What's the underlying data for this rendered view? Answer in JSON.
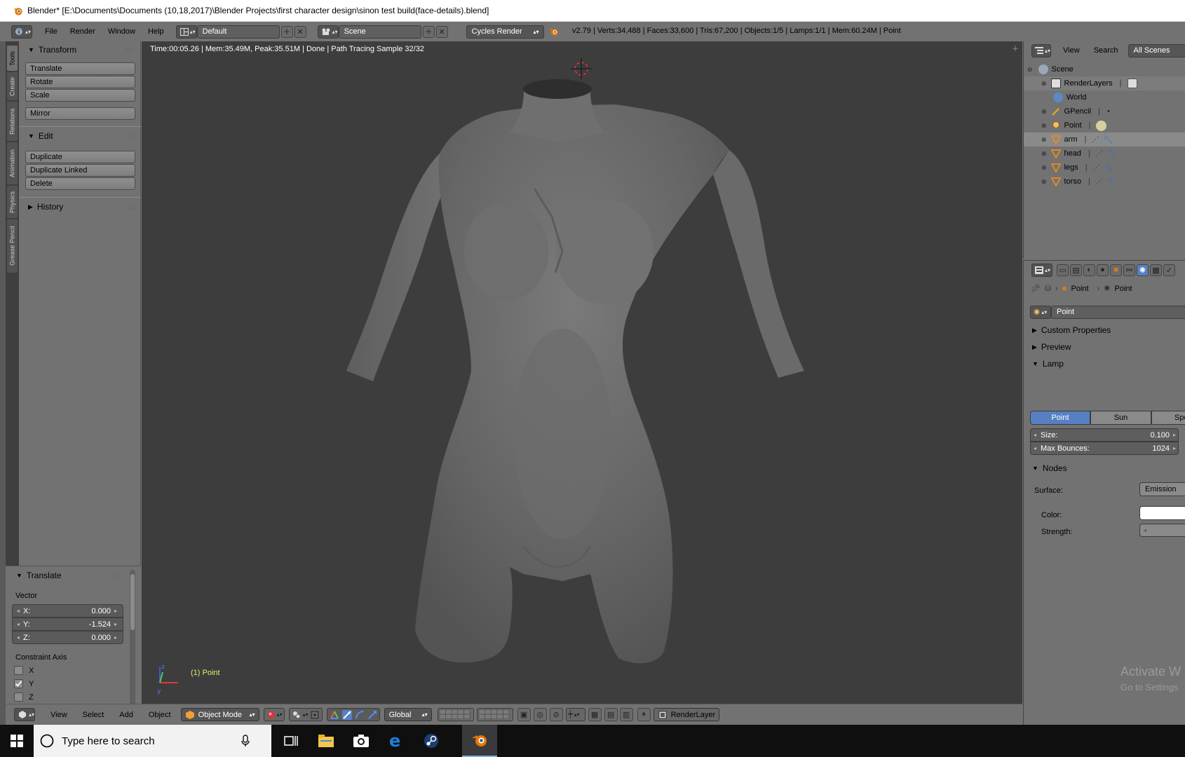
{
  "window": {
    "title": "Blender* [E:\\Documents\\Documents (10,18,2017)\\Blender Projects\\first character design\\sinon test build(face-details).blend]"
  },
  "infobar": {
    "menus": [
      "File",
      "Render",
      "Window",
      "Help"
    ],
    "layout": "Default",
    "scene": "Scene",
    "engine": "Cycles Render",
    "stats": "v2.79 | Verts:34,488 | Faces:33,600 | Tris:67,200 | Objects:1/5 | Lamps:1/1 | Mem:60.24M | Point"
  },
  "vtabs": [
    "Tools",
    "Create",
    "Relations",
    "Animation",
    "Physics",
    "Grease Pencil"
  ],
  "toolshelf": {
    "transform": {
      "title": "Transform",
      "buttons": [
        "Translate",
        "Rotate",
        "Scale",
        "Mirror"
      ]
    },
    "edit": {
      "title": "Edit",
      "buttons": [
        "Duplicate",
        "Duplicate Linked",
        "Delete"
      ]
    },
    "history": {
      "title": "History"
    }
  },
  "operator": {
    "title": "Translate",
    "vector_label": "Vector",
    "x_label": "X:",
    "x": "0.000",
    "y_label": "Y:",
    "y": "-1.524",
    "z_label": "Z:",
    "z": "0.000",
    "constraint_label": "Constraint Axis",
    "axes": [
      {
        "label": "X",
        "checked": false
      },
      {
        "label": "Y",
        "checked": true
      },
      {
        "label": "Z",
        "checked": false
      }
    ]
  },
  "viewport": {
    "render_info": "Time:00:05.26 | Mem:35.49M, Peak:35.51M | Done | Path Tracing Sample 32/32",
    "object_label": "(1) Point"
  },
  "view3d_header": {
    "menus": [
      "View",
      "Select",
      "Add",
      "Object"
    ],
    "mode": "Object Mode",
    "orientation": "Global",
    "render_layer": "RenderLayer"
  },
  "outliner": {
    "menus": [
      "View",
      "Search"
    ],
    "filter": "All Scenes",
    "items": [
      {
        "label": "Scene",
        "icon": "scene-icon",
        "indent": 0
      },
      {
        "label": "RenderLayers",
        "icon": "renderlayers-icon",
        "indent": 1
      },
      {
        "label": "World",
        "icon": "world-icon",
        "indent": 1
      },
      {
        "label": "GPencil",
        "icon": "gpencil-icon",
        "indent": 1
      },
      {
        "label": "Point",
        "icon": "lamp-icon",
        "indent": 1
      },
      {
        "label": "arm",
        "icon": "mesh-icon",
        "indent": 1
      },
      {
        "label": "head",
        "icon": "mesh-icon",
        "indent": 1
      },
      {
        "label": "legs",
        "icon": "mesh-icon",
        "indent": 1
      },
      {
        "label": "torso",
        "icon": "mesh-icon",
        "indent": 1
      }
    ]
  },
  "properties": {
    "breadcrumb": [
      "Point",
      "Point"
    ],
    "datablock": "Point",
    "custom_properties": "Custom Properties",
    "preview": "Preview",
    "lamp": "Lamp",
    "lamp_types": [
      "Point",
      "Sun",
      "Spo"
    ],
    "size_label": "Size:",
    "size": "0.100",
    "bounces_label": "Max Bounces:",
    "bounces": "1024",
    "nodes": "Nodes",
    "surface_label": "Surface:",
    "surface": "Emission",
    "color_label": "Color:",
    "strength_label": "Strength:"
  },
  "watermark": {
    "line1": "Activate W",
    "line2": "Go to Settings"
  },
  "taskbar": {
    "search_placeholder": "Type here to search"
  },
  "colors": {
    "accent": "#5680c2",
    "viewport_bg": "#3d3d3d",
    "panel": "#727272"
  }
}
